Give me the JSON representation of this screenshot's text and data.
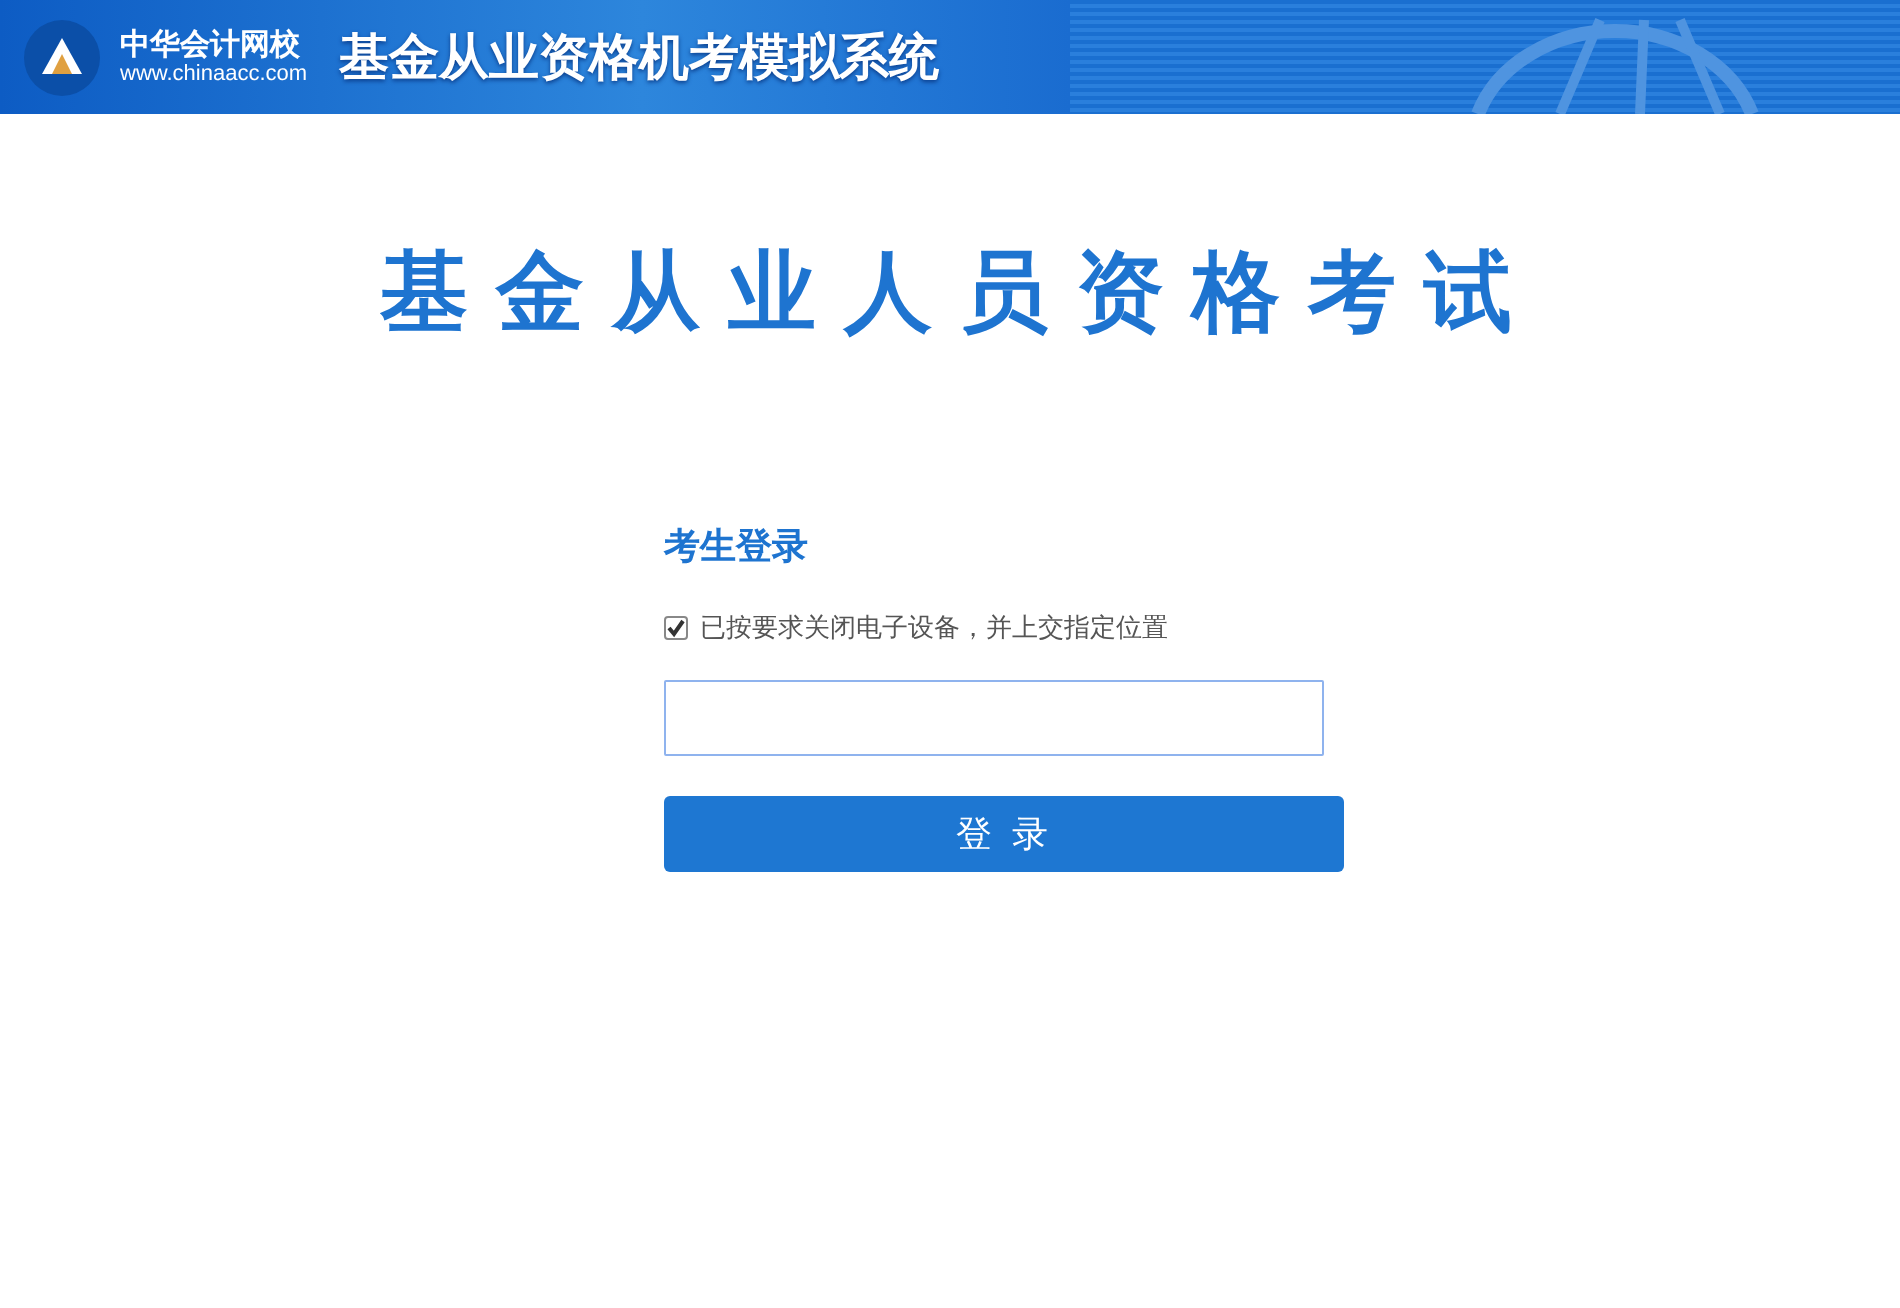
{
  "header": {
    "school_name": "中华会计网校",
    "school_url": "www.chinaacc.com",
    "system_title": "基金从业资格机考模拟系统"
  },
  "exam_title": "基金从业人员资格考试",
  "login": {
    "heading": "考生登录",
    "agreement": {
      "label": "已按要求关闭电子设备，并上交指定位置",
      "checked": true
    },
    "button": "登 录"
  }
}
